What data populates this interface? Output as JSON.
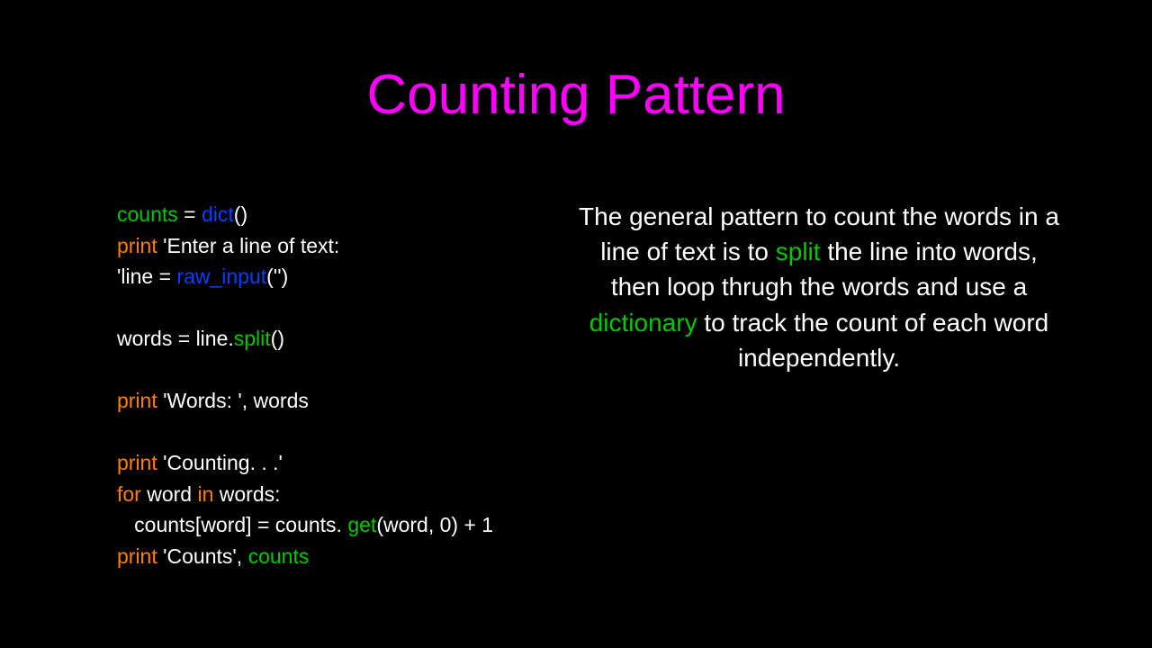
{
  "title": "Counting Pattern",
  "code": {
    "l1": {
      "a": "counts",
      "b": " = ",
      "c": "dict",
      "d": "()"
    },
    "l2": {
      "a": "print",
      "b": " 'Enter a line of text:"
    },
    "l3": {
      "a": "'line = ",
      "b": "raw_input",
      "c": "('')"
    },
    "l4": "",
    "l5": {
      "a": "words = line.",
      "b": "split",
      "c": "()"
    },
    "l6": "",
    "l7": {
      "a": "print",
      "b": " 'Words: ', words"
    },
    "l8": "",
    "l9": {
      "a": "print",
      "b": " 'Counting. . .'"
    },
    "l10": {
      "a": "for",
      "b": " word ",
      "c": "in",
      "d": " words:"
    },
    "l11": {
      "a": "   counts[word] = counts. ",
      "b": "get",
      "c": "(word, 0) + 1"
    },
    "l12": {
      "a": "print",
      "b": " 'Counts', ",
      "c": "counts"
    }
  },
  "desc": {
    "p1": "The general pattern to count the words in a line of text is to ",
    "p2": "split",
    "p3": " the line into words, then loop thrugh the words and use a ",
    "p4": "dictionary",
    "p5": " to track the count of each word independently."
  }
}
